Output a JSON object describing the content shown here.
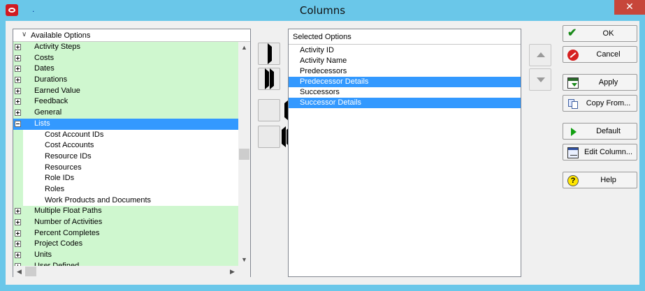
{
  "window": {
    "title": "Columns",
    "title_dot": ".",
    "close_glyph": "✕"
  },
  "available": {
    "header": "Available Options",
    "header_icon": "chevron-down-icon",
    "rows": [
      {
        "label": "Activity Steps",
        "type": "category",
        "expanded": false
      },
      {
        "label": "Costs",
        "type": "category",
        "expanded": false
      },
      {
        "label": "Dates",
        "type": "category",
        "expanded": false
      },
      {
        "label": "Durations",
        "type": "category",
        "expanded": false
      },
      {
        "label": "Earned Value",
        "type": "category",
        "expanded": false
      },
      {
        "label": "Feedback",
        "type": "category",
        "expanded": false
      },
      {
        "label": "General",
        "type": "category",
        "expanded": false
      },
      {
        "label": "Lists",
        "type": "category",
        "expanded": true,
        "selected": true
      },
      {
        "label": "Cost Account IDs",
        "type": "child"
      },
      {
        "label": "Cost Accounts",
        "type": "child"
      },
      {
        "label": "Resource IDs",
        "type": "child"
      },
      {
        "label": "Resources",
        "type": "child"
      },
      {
        "label": "Role IDs",
        "type": "child"
      },
      {
        "label": "Roles",
        "type": "child"
      },
      {
        "label": "Work Products and Documents",
        "type": "child"
      },
      {
        "label": "Multiple Float Paths",
        "type": "category",
        "expanded": false
      },
      {
        "label": "Number of Activities",
        "type": "category",
        "expanded": false
      },
      {
        "label": "Percent Completes",
        "type": "category",
        "expanded": false
      },
      {
        "label": "Project Codes",
        "type": "category",
        "expanded": false
      },
      {
        "label": "Units",
        "type": "category",
        "expanded": false
      },
      {
        "label": "User Defined",
        "type": "category",
        "expanded": false
      }
    ],
    "scroll_up_glyph": "▲",
    "scroll_down_glyph": "▼",
    "scroll_left_glyph": "◀",
    "scroll_right_glyph": "▶"
  },
  "selected": {
    "header": "Selected Options",
    "items": [
      {
        "label": "Activity ID",
        "highlighted": false
      },
      {
        "label": "Activity Name",
        "highlighted": false
      },
      {
        "label": "Predecessors",
        "highlighted": false
      },
      {
        "label": "Predecessor Details",
        "highlighted": true
      },
      {
        "label": "Successors",
        "highlighted": false
      },
      {
        "label": "Successor Details",
        "highlighted": true
      }
    ]
  },
  "transfer": {
    "add_icon": "arrow-right-icon",
    "add_all_icon": "double-arrow-right-icon",
    "remove_icon": "arrow-left-icon",
    "remove_all_icon": "double-arrow-left-icon"
  },
  "commands": {
    "ok": "OK",
    "cancel": "Cancel",
    "apply": "Apply",
    "copy_from": "Copy From...",
    "default": "Default",
    "edit_column": "Edit Column...",
    "help": "Help",
    "help_glyph": "?",
    "ok_glyph": "✔"
  },
  "colors": {
    "titlebar": "#6ac7e9",
    "category_bg": "#cff7cf",
    "selection": "#3399ff",
    "close_button": "#c7463a"
  }
}
